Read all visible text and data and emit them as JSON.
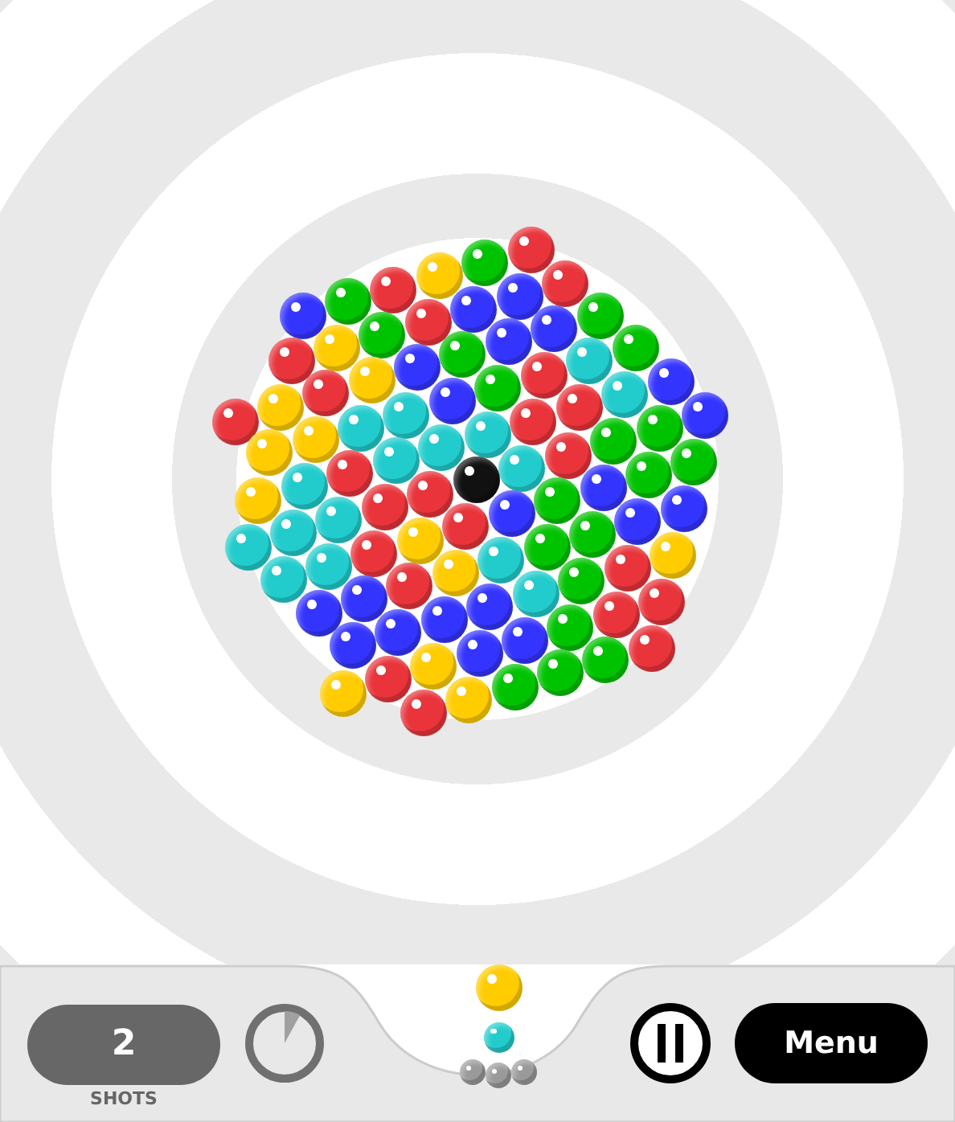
{
  "board": {
    "bubbles": [
      {
        "color": "#e8343a"
      },
      {
        "color": "#00c300"
      },
      {
        "color": "#ffcc00"
      },
      {
        "color": "#e8343a"
      },
      {
        "color": "#00c300"
      },
      {
        "color": "#3434ff"
      },
      {
        "color": "#e8343a"
      },
      {
        "color": "#3434ff"
      },
      {
        "color": "#3434ff"
      },
      {
        "color": "#e8343a"
      },
      {
        "color": "#00c300"
      },
      {
        "color": "#ffcc00"
      },
      {
        "color": "#e8343a"
      },
      {
        "color": "#00c300"
      },
      {
        "color": "#3434ff"
      },
      {
        "color": "#3434ff"
      },
      {
        "color": "#00c300"
      },
      {
        "color": "#3434ff"
      },
      {
        "color": "#ffcc00"
      },
      {
        "color": "#e8343a"
      },
      {
        "color": "#ffcc00"
      },
      {
        "color": "#e8343a"
      },
      {
        "color": "#00c300"
      },
      {
        "color": "#22cccc"
      },
      {
        "color": "#e8343a"
      },
      {
        "color": "#00c300"
      },
      {
        "color": "#3434ff"
      },
      {
        "color": "#22cccc"
      },
      {
        "color": "#22cccc"
      },
      {
        "color": "#ffcc00"
      },
      {
        "color": "#ffcc00"
      },
      {
        "color": "#3434ff"
      },
      {
        "color": "#22cccc"
      },
      {
        "color": "#e8343a"
      },
      {
        "color": "#e8343a"
      },
      {
        "color": "#22cccc"
      },
      {
        "color": "#22cccc"
      },
      {
        "color": "#22cccc"
      },
      {
        "color": "#e8343a"
      },
      {
        "color": "#22cccc"
      },
      {
        "color": "#ffcc00"
      },
      {
        "color": "#3434ff"
      },
      {
        "color": "#00c300"
      },
      {
        "color": "#00c300"
      },
      {
        "color": "#e8343a"
      },
      {
        "color": "#22cccc"
      },
      {
        "color": "#111111"
      },
      {
        "color": "#e8343a"
      },
      {
        "color": "#e8343a"
      },
      {
        "color": "#22cccc"
      },
      {
        "color": "#22cccc"
      },
      {
        "color": "#22cccc"
      },
      {
        "color": "#00c300"
      },
      {
        "color": "#00c300"
      },
      {
        "color": "#3434ff"
      },
      {
        "color": "#00c300"
      },
      {
        "color": "#3434ff"
      },
      {
        "color": "#e8343a"
      },
      {
        "color": "#ffcc00"
      },
      {
        "color": "#e8343a"
      },
      {
        "color": "#22cccc"
      },
      {
        "color": "#22cccc"
      },
      {
        "color": "#3434ff"
      },
      {
        "color": "#3434ff"
      },
      {
        "color": "#00c300"
      },
      {
        "color": "#00c300"
      },
      {
        "color": "#22cccc"
      },
      {
        "color": "#ffcc00"
      },
      {
        "color": "#e8343a"
      },
      {
        "color": "#3434ff"
      },
      {
        "color": "#3434ff"
      },
      {
        "color": "#ffcc00"
      },
      {
        "color": "#e8343a"
      },
      {
        "color": "#00c300"
      },
      {
        "color": "#22cccc"
      },
      {
        "color": "#3434ff"
      },
      {
        "color": "#3434ff"
      },
      {
        "color": "#3434ff"
      },
      {
        "color": "#3434ff"
      },
      {
        "color": "#e8343a"
      },
      {
        "color": "#e8343a"
      },
      {
        "color": "#00c300"
      },
      {
        "color": "#3434ff"
      },
      {
        "color": "#3434ff"
      },
      {
        "color": "#ffcc00"
      },
      {
        "color": "#e8343a"
      },
      {
        "color": "#ffcc00"
      },
      {
        "color": "#e8343a"
      },
      {
        "color": "#00c300"
      },
      {
        "color": "#00c300"
      },
      {
        "color": "#00c300"
      },
      {
        "color": "#ffcc00"
      },
      {
        "color": "#e8343a"
      }
    ]
  },
  "shots": {
    "value": "2",
    "label": "SHOTS"
  },
  "timer": {
    "level": 0.08
  },
  "launcher": {
    "current": {
      "color": "#ffcc00"
    },
    "next": {
      "color": "#22cccc"
    },
    "reserve": [
      {
        "kind": "empty"
      },
      {
        "kind": "empty"
      },
      {
        "kind": "empty"
      }
    ]
  },
  "menu_button": {
    "label": "Menu"
  }
}
